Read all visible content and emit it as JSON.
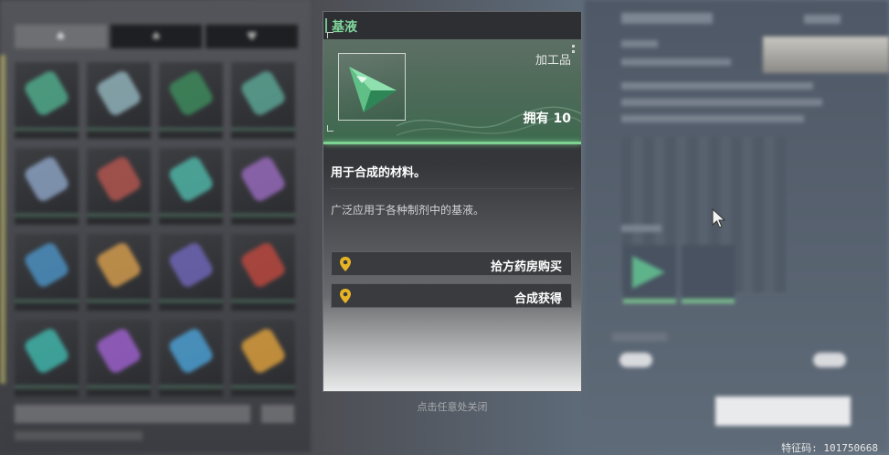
{
  "popup": {
    "title": "基液",
    "category": "加工品",
    "owned": "拥有 10",
    "summary": "用于合成的材料。",
    "description": "广泛应用于各种制剂中的基液。",
    "sources": [
      {
        "label": "拾方药房购买",
        "icon": "location-pin-icon"
      },
      {
        "label": "合成获得",
        "icon": "location-pin-icon"
      }
    ]
  },
  "close_hint": "点击任意处关闭",
  "feature_code": "特征码: 101750668",
  "colors": {
    "accent": "#7ed59a",
    "banner": "#4c6a58",
    "pin": "#e6b325"
  }
}
